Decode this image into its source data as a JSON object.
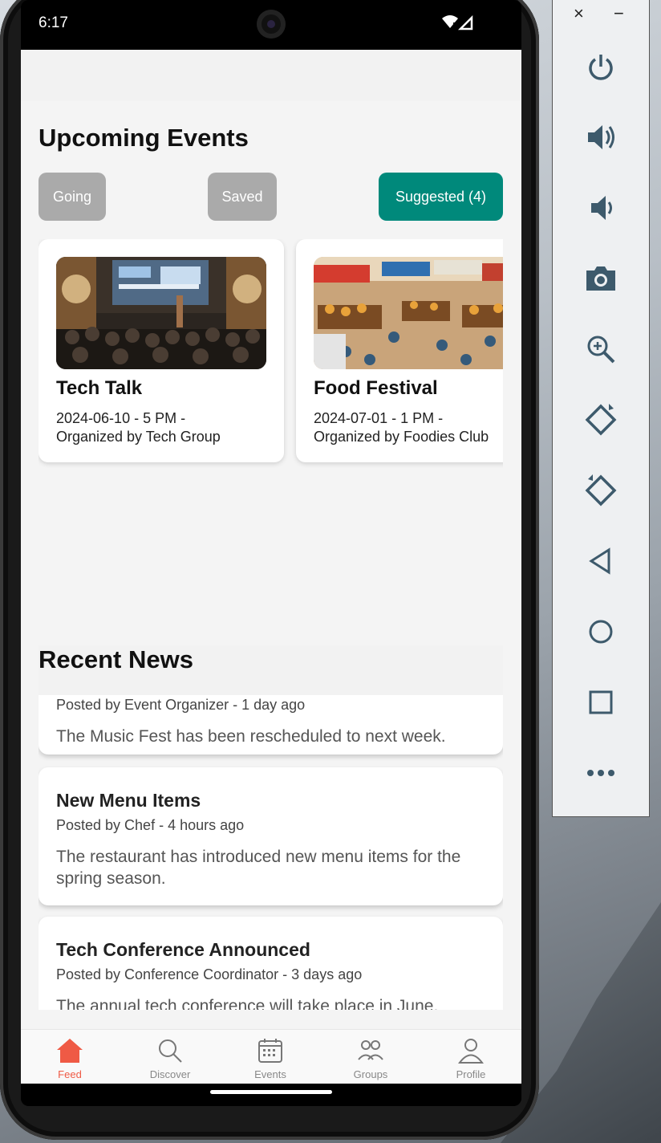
{
  "status_bar": {
    "time": "6:17"
  },
  "upcoming": {
    "title": "Upcoming Events",
    "filters": {
      "going": "Going",
      "saved": "Saved",
      "suggested": "Suggested (4)"
    },
    "accent_color": "#00897b",
    "events": [
      {
        "title": "Tech Talk",
        "date_line": "2024-06-10 - 5 PM -",
        "organizer_line": "Organized by Tech Group",
        "image": "conference-stage-photo"
      },
      {
        "title": "Food Festival",
        "date_line": "2024-07-01 - 1 PM -",
        "organizer_line": "Organized by Foodies Club",
        "image": "food-market-illustration"
      }
    ]
  },
  "news": {
    "title": "Recent News",
    "items": [
      {
        "meta": "Posted by Event Organizer - 1 day ago",
        "body": "The Music Fest has been rescheduled to next week."
      },
      {
        "title": "New Menu Items",
        "meta": "Posted by Chef - 4 hours ago",
        "body": "The restaurant has introduced new menu items for the spring season."
      },
      {
        "title": "Tech Conference Announced",
        "meta": "Posted by Conference Coordinator - 3 days ago",
        "body": "The annual tech conference will take place in June."
      }
    ]
  },
  "bottom_nav": {
    "active_color": "#ef5a45",
    "items": [
      {
        "label": "Feed",
        "icon": "home-icon"
      },
      {
        "label": "Discover",
        "icon": "search-icon"
      },
      {
        "label": "Events",
        "icon": "calendar-icon"
      },
      {
        "label": "Groups",
        "icon": "groups-icon"
      },
      {
        "label": "Profile",
        "icon": "person-icon"
      }
    ]
  },
  "emulator_panel": {
    "window_controls": {
      "close": "×",
      "minimize": "−"
    },
    "buttons": [
      "power-icon",
      "volume-up-icon",
      "volume-down-icon",
      "camera-icon",
      "zoom-icon",
      "rotate-left-icon",
      "rotate-right-icon",
      "back-icon",
      "home-circle-icon",
      "overview-icon",
      "more-icon"
    ]
  }
}
